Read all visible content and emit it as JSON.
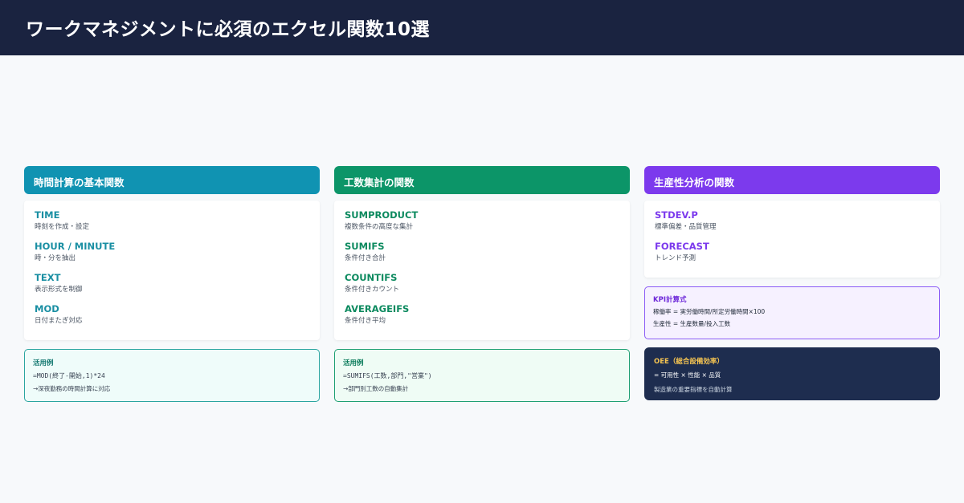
{
  "header": {
    "title": "ワークマネジメントに必須のエクセル関数10選"
  },
  "columns": [
    {
      "title": "時間計算の基本関数",
      "functions": [
        {
          "name": "TIME",
          "desc": "時刻を作成・設定"
        },
        {
          "name": "HOUR / MINUTE",
          "desc": "時・分を抽出"
        },
        {
          "name": "TEXT",
          "desc": "表示形式を制御"
        },
        {
          "name": "MOD",
          "desc": "日付またぎ対応"
        }
      ],
      "example": {
        "title": "活用例",
        "code": "=MOD(終了-開始,1)*24",
        "note": "→深夜勤務の時間計算に対応"
      }
    },
    {
      "title": "工数集計の関数",
      "functions": [
        {
          "name": "SUMPRODUCT",
          "desc": "複数条件の高度な集計"
        },
        {
          "name": "SUMIFS",
          "desc": "条件付き合計"
        },
        {
          "name": "COUNTIFS",
          "desc": "条件付きカウント"
        },
        {
          "name": "AVERAGEIFS",
          "desc": "条件付き平均"
        }
      ],
      "example": {
        "title": "活用例",
        "code": "=SUMIFS(工数,部門,\"営業\")",
        "note": "→部門別工数の自動集計"
      }
    },
    {
      "title": "生産性分析の関数",
      "functions": [
        {
          "name": "STDEV.P",
          "desc": "標準偏差・品質管理"
        },
        {
          "name": "FORECAST",
          "desc": "トレンド予測"
        }
      ],
      "kpi": {
        "title": "KPI計算式",
        "line1": "稼働率 = 実労働時間/所定労働時間×100",
        "line2": "生産性 = 生産数量/投入工数"
      },
      "oee": {
        "title": "OEE（総合設備効率）",
        "formula": "= 可用性 × 性能 × 品質",
        "note": "製造業の重要指標を自動計算"
      }
    }
  ],
  "colors": {
    "header_bg": "#1a2340",
    "teal": "#1093b2",
    "green": "#0c9568",
    "purple": "#7c3aed",
    "oee_bg": "#1e2d4f",
    "oee_title": "#f5c451"
  }
}
